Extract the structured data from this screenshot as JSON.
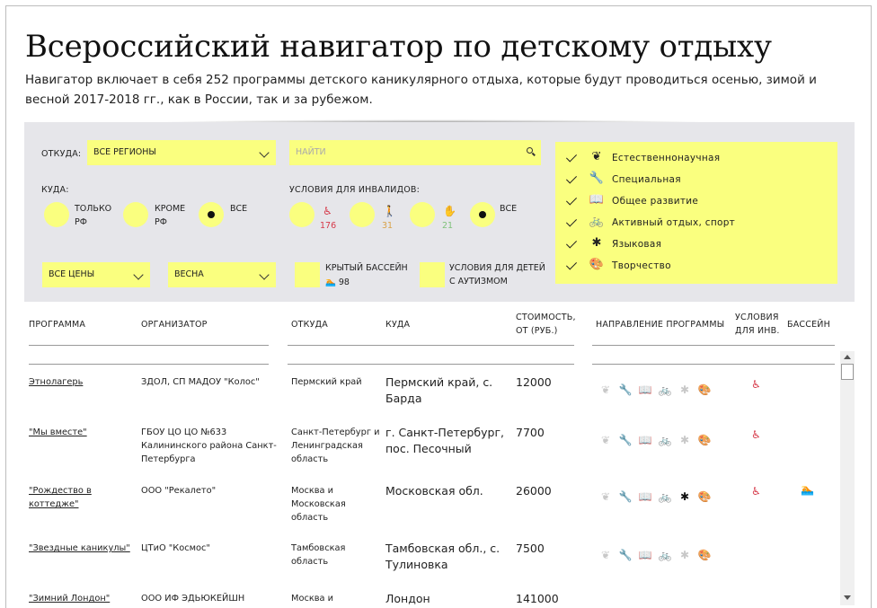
{
  "page": {
    "title": "Всероссийский навигатор по детскому отдыху",
    "subtitle": "Навигатор включает в себя 252 программы детского каникулярного отдыха, которые будут проводиться осенью, зимой и весной 2017-2018 гг., как в России, так и за рубежом."
  },
  "filters": {
    "from_label": "ОТКУДА:",
    "from_value": "ВСЕ РЕГИОНЫ",
    "search_placeholder": "НАЙТИ",
    "to_label": "КУДА:",
    "to_opt1_a": "ТОЛЬКО",
    "to_opt1_b": "РФ",
    "to_opt2_a": "КРОМЕ",
    "to_opt2_b": "РФ",
    "to_opt3": "ВСЕ",
    "disabled_label": "УСЛОВИЯ ДЛЯ ИНВАЛИДОВ:",
    "dis_count1": "176",
    "dis_count2": "31",
    "dis_count3": "21",
    "dis_all": "ВСЕ",
    "dis_color1": "#d63a4a",
    "dis_color2": "#d9a24a",
    "dis_color3": "#7fc27a",
    "price_value": "ВСЕ ЦЕНЫ",
    "season_value": "ВЕСНА",
    "pool_label": "КРЫТЫЙ БАССЕЙН",
    "pool_count": "98",
    "autism_a": "УСЛОВИЯ ДЛЯ ДЕТЕЙ",
    "autism_b": "С АУТИЗМОМ",
    "directions": [
      {
        "icon": "leaf-icon",
        "label": "Естественнонаучная"
      },
      {
        "icon": "wrench-icon",
        "label": "Специальная"
      },
      {
        "icon": "book-icon",
        "label": "Общее развитие"
      },
      {
        "icon": "bicycle-icon",
        "label": "Активный отдых, спорт"
      },
      {
        "icon": "uk-flag-icon",
        "label": "Языковая"
      },
      {
        "icon": "palette-icon",
        "label": "Творчество"
      }
    ]
  },
  "table": {
    "headers": {
      "program": "ПРОГРАММА",
      "organizer": "ОРГАНИЗАТОР",
      "from": "ОТКУДА",
      "to": "КУДА",
      "price_a": "СТОИМОСТЬ,",
      "price_b": "ОТ (РУБ.)",
      "direction": "НАПРАВЛЕНИЕ ПРОГРАММЫ",
      "disabled_a": "УСЛОВИЯ",
      "disabled_b": "ДЛЯ ИНВ.",
      "pool": "БАССЕЙН"
    },
    "rows": [
      {
        "program": "Этнолагерь",
        "organizer": "ЗДОЛ, СП МАДОУ \"Колос\"",
        "from": "Пермский край",
        "to": "Пермский край, с. Барда",
        "price": "12000"
      },
      {
        "program": "\"Мы вместе\"",
        "organizer": "ГБОУ ЦО ЦО №633 Калининского района Санкт-Петербурга",
        "from": "Санкт-Петербург и Ленинградская область",
        "to": "г. Санкт-Петербург, пос. Песочный",
        "price": "7700"
      },
      {
        "program": "\"Рождество в коттедже\"",
        "organizer": "ООО \"Рекалето\"",
        "from": "Москва и Московская область",
        "to": "Московская обл.",
        "price": "26000"
      },
      {
        "program": "\"Звездные каникулы\"",
        "organizer": "ЦТиО \"Космос\"",
        "from": "Тамбовская область",
        "to": "Тамбовская обл., с. Тулиновка",
        "price": "7500"
      },
      {
        "program": "\"Зимний Лондон\"",
        "organizer": "ООО ИФ ЭДЬЮКЕЙШН",
        "from": "Москва и",
        "to": "Лондон",
        "price": "141000"
      }
    ]
  }
}
